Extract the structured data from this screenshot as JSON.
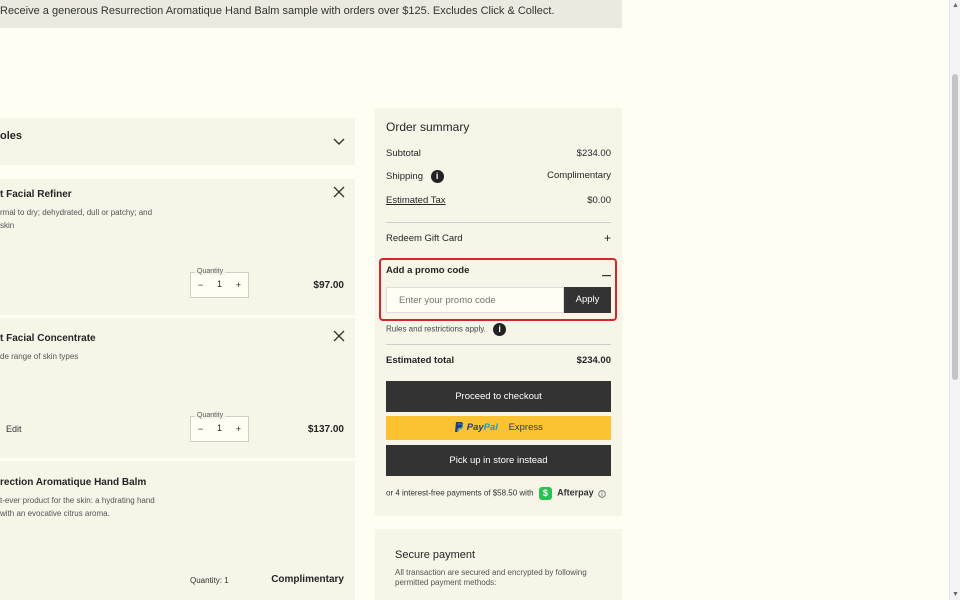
{
  "banner": {
    "text": "Receive a generous Resurrection Aromatique Hand Balm sample with orders over $125. Excludes Click & Collect."
  },
  "bag": {
    "header_label": "oles"
  },
  "items": [
    {
      "name": "t Facial Refiner",
      "desc_line1": "rmal to dry; dehydrated, dull or patchy; and",
      "desc_line2": "skin",
      "qty_label": "Quantity",
      "qty": "1",
      "price": "$97.00"
    },
    {
      "name": "t Facial Concentrate",
      "desc_line1": "de range of skin types",
      "edit_label": "Edit",
      "qty_label": "Quantity",
      "qty": "1",
      "price": "$137.00"
    },
    {
      "name": "rection Aromatique Hand Balm",
      "desc_line1": "t-ever product for the skin: a hydrating hand",
      "desc_line2": "with an evocative citrus aroma.",
      "qty_text": "Quantity: 1",
      "price": "Complimentary"
    }
  ],
  "summary": {
    "title": "Order summary",
    "subtotal_label": "Subtotal",
    "subtotal_value": "$234.00",
    "shipping_label": "Shipping",
    "shipping_value": "Complimentary",
    "tax_label": "Estimated Tax",
    "tax_value": "$0.00",
    "gift_card_label": "Redeem Gift Card",
    "promo_label": "Add a promo code",
    "promo_placeholder": "Enter your promo code",
    "apply_label": "Apply",
    "rules_label": "Rules and restrictions apply.",
    "total_label": "Estimated total",
    "total_value": "$234.00",
    "checkout_label": "Proceed to checkout",
    "paypal_pay": "Pay",
    "paypal_pal": "Pal",
    "paypal_express": "Express",
    "pickup_label": "Pick up in store instead",
    "afterpay_text": "or 4 interest-free payments of $58.50 with",
    "afterpay_badge": "$",
    "afterpay_name": "Afterpay"
  },
  "secure": {
    "title": "Secure payment",
    "desc": "All transaction are secured and encrypted by following permitted payment methods:"
  },
  "icons": {
    "info": "i",
    "close": "✕",
    "chevron": "⌄",
    "plus": "+",
    "minus": "−",
    "dash": "—"
  }
}
